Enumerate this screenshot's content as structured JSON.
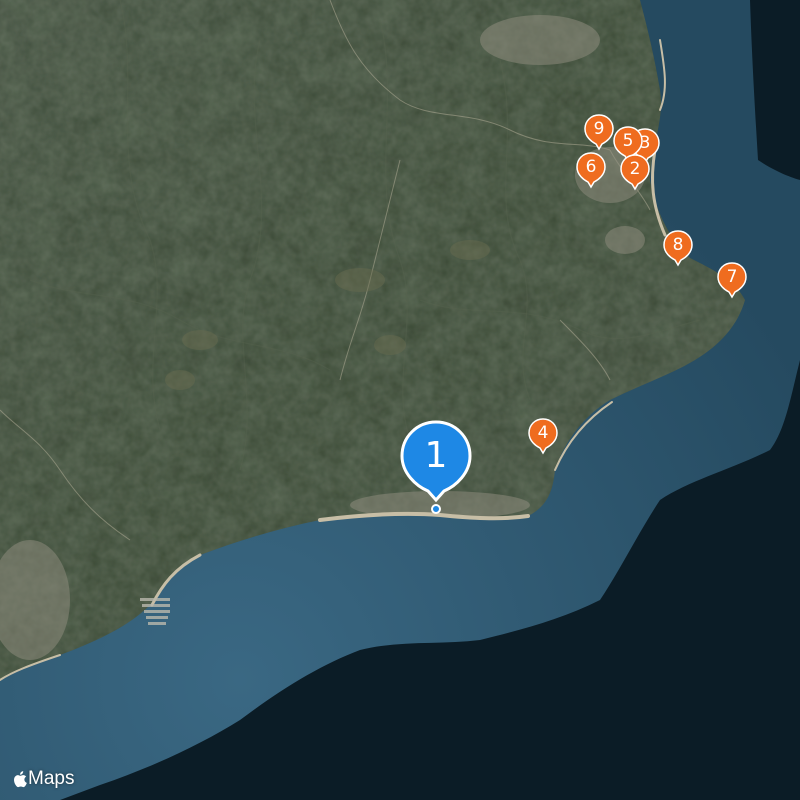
{
  "map": {
    "type": "satellite",
    "colors": {
      "deep_sea": "#0b1c26",
      "shallow_sea": "#2f5d78",
      "land": "#3b4a38",
      "beach": "#b8ad93",
      "pin_primary": "#1e88e5",
      "pin_secondary": "#ef6c1f"
    }
  },
  "pins": {
    "primary": {
      "label": "1"
    },
    "p2": {
      "label": "2"
    },
    "p3": {
      "label": "3"
    },
    "p4": {
      "label": "4"
    },
    "p5": {
      "label": "5"
    },
    "p6": {
      "label": "6"
    },
    "p7": {
      "label": "7"
    },
    "p8": {
      "label": "8"
    },
    "p9": {
      "label": "9"
    }
  },
  "attribution": {
    "label": "Maps",
    "icon": "apple-logo-icon"
  }
}
